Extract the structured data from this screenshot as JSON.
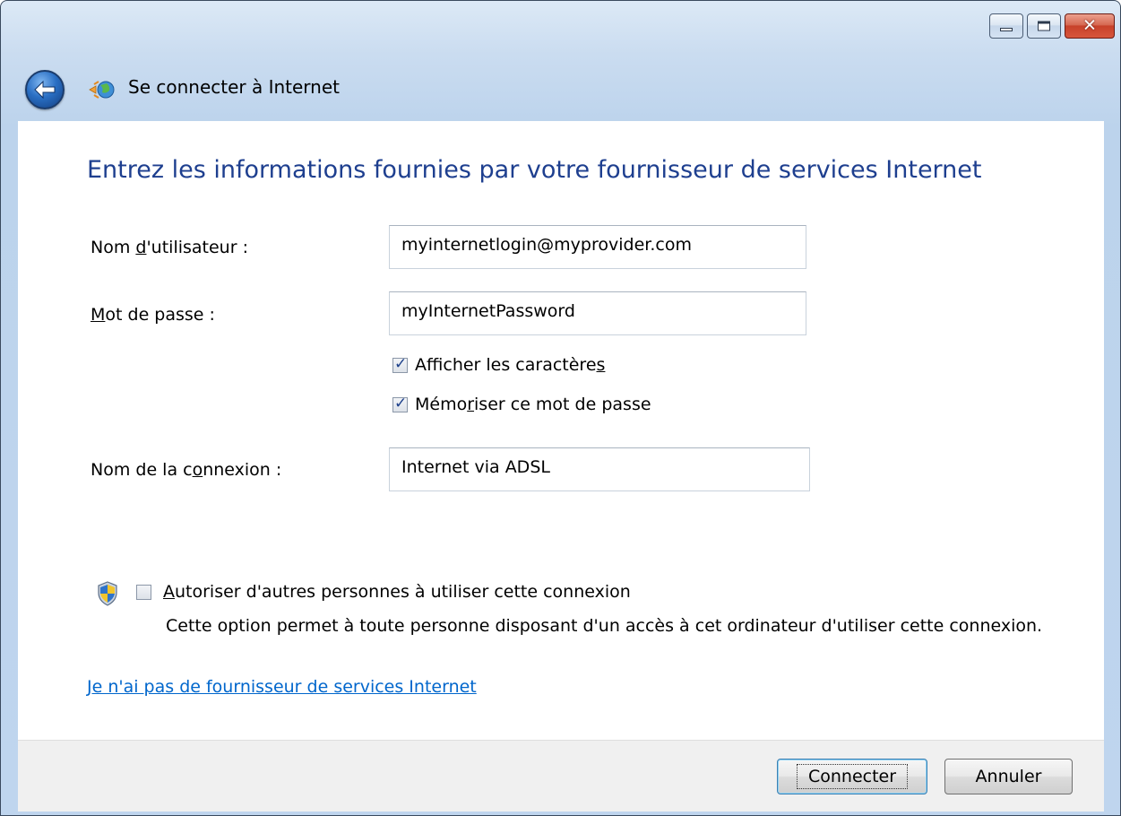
{
  "window": {
    "title": "Se connecter à Internet",
    "controls": {
      "minimize": "minimize",
      "maximize": "maximize",
      "close": "close"
    }
  },
  "heading": "Entrez les informations fournies par votre fournisseur de services Internet",
  "form": {
    "username_label_pre": "Nom ",
    "username_label_key": "d",
    "username_label_post": "'utilisateur :",
    "username_value": "myinternetlogin@myprovider.com",
    "password_label_key": "M",
    "password_label_post": "ot de passe :",
    "password_value": "myInternetPassword",
    "show_chars_pre": "Afficher les caractère",
    "show_chars_key": "s",
    "show_chars_checked": true,
    "remember_pre": "Mémo",
    "remember_key": "r",
    "remember_post": "iser ce mot de passe",
    "remember_checked": true,
    "connection_label_pre": "Nom de la c",
    "connection_label_key": "o",
    "connection_label_post": "nnexion :",
    "connection_value": "Internet via ADSL"
  },
  "share": {
    "label_key": "A",
    "label_post": "utoriser d'autres personnes à utiliser cette connexion",
    "checked": false,
    "description": "Cette option permet à toute personne disposant d'un accès à cet ordinateur d'utiliser cette connexion."
  },
  "link": "Je n'ai pas de fournisseur de services Internet",
  "buttons": {
    "connect": "Connecter",
    "cancel": "Annuler"
  },
  "colors": {
    "heading": "#1e3f8f",
    "link": "#0066cc",
    "frame": "#bfd5ee"
  }
}
